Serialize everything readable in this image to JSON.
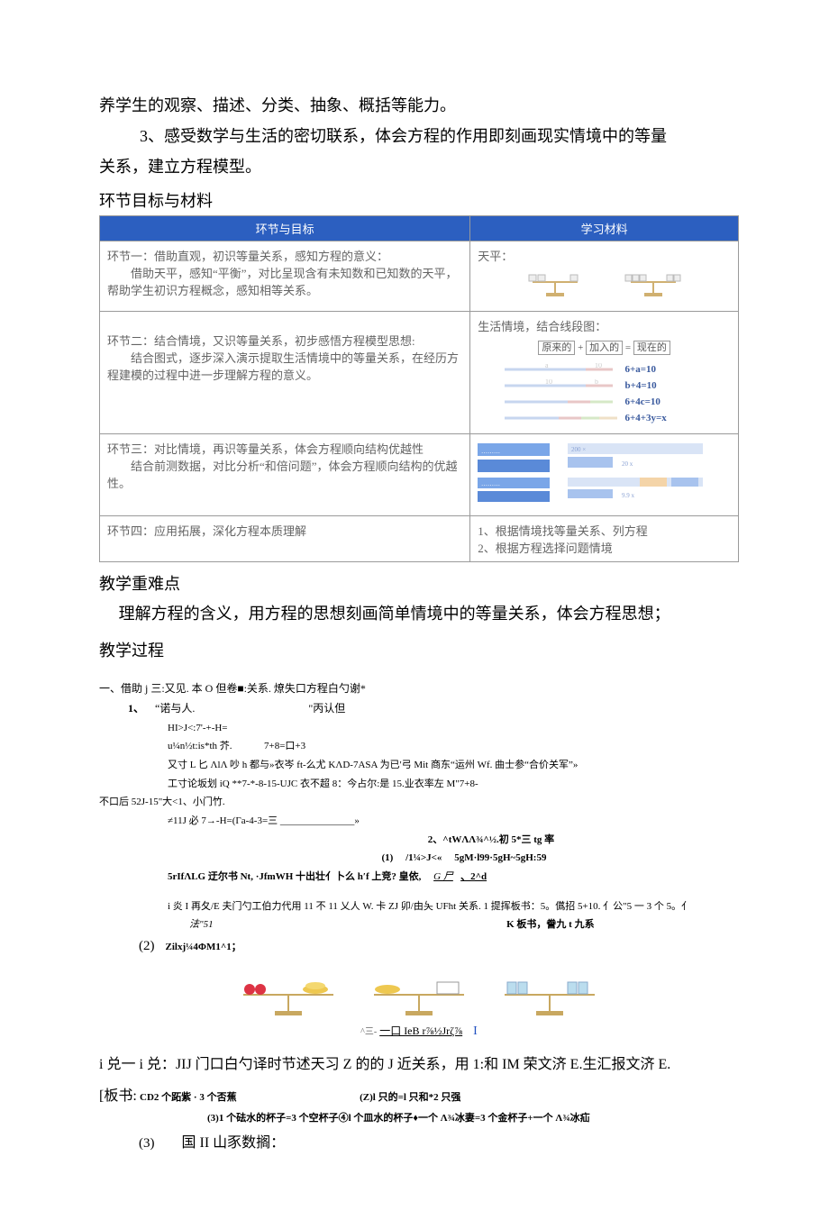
{
  "top_paragraphs": {
    "p1": "养学生的观察、描述、分类、抽象、概括等能力。",
    "p2_prefix": "3、感受数学与生活的密切联系，体会方程的作用即刻画现实情境中的等量",
    "p2_suffix": "关系，建立方程模型。"
  },
  "sections": {
    "head1": "环节目标与材料",
    "head2": "教学重难点",
    "sub2": "理解方程的含义，用方程的思想刻画简单情境中的等量关系，体会方程思想；",
    "head3": "教学过程"
  },
  "table": {
    "h_left": "环节与目标",
    "h_right": "学习材料",
    "rows": [
      {
        "left_lines": [
          "环节一：借助直观，初识等量关系，感知方程的意义：",
          "借助天平，感知“平衡”，对比呈现含有未知数和已知数的天平，帮助学生初识方程概念，感知相等关系。"
        ],
        "right_title": "天平："
      },
      {
        "left_lines": [
          "环节二：结合情境，又识等量关系，初步感悟方程模型思想:",
          "结合图式，逐步深入演示提取生活情境中的等量关系，在经历方程建模的过程中进一步理解方程的意义。"
        ],
        "right_title": "生活情境，结合线段图：",
        "box_labels": [
          "原来的",
          "加入的",
          "现在的"
        ],
        "eqs": [
          "6+a=10",
          "b+4=10",
          "6+4c=10",
          "6+4+3y=x"
        ]
      },
      {
        "left_lines": [
          "环节三：对比情境，再识等量关系，体会方程顺向结构优越性",
          "结合前测数据，对比分析“和倍问题”，体会方程顺向结构的优越性。"
        ]
      },
      {
        "left_lines": [
          "环节四：应用拓展，深化方程本质理解"
        ],
        "right_lines": [
          "1、根据情境找等量关系、列方程",
          "2、根据方程选择问题情境"
        ]
      }
    ]
  },
  "process": {
    "l1": "一、借助 j 三:又见. 本 O 但卷■:关系. 燎失口方程白勺谢*",
    "l2_left": "1、",
    "l2_mid": "“诺与人.",
    "l2_right": "\"丙认但",
    "l3": "HI>J<:7'-+-H=",
    "l4_left": "u¼n½t:is*th 芥.",
    "l4_right": "7+8=口+3",
    "l5": "又寸 L 匕 ΛlΛ 吵 h 都与»衣岑 ft-么尤 KΛD-7ASA 为已'弓 Mit 商东“运州 Wf.    曲士参“合价关军”»",
    "l6": "工寸论坂划 iQ     **7-*-8-15-UJC 衣不超 8：今占尔:是 15.业衣率左 M\"7+8-",
    "l7": "不口后 52J-15\"大<1、小门竹.",
    "l8": "≠11J 必 7→-H=(Γa-4-3=三 _______________»",
    "l9": "2、^tWΛΛ¾^½.初 5*三 tg 率",
    "l10_a": "(1)",
    "l10_b": "/1¼>J<«",
    "l10_c": "5gM·l99·5gH~5gH:59",
    "l11_a": "5rIfΛLG 迂尔书 Nt, ·JfmWH 十出壮亻卜么 hʹf 上竞? 皇依,",
    "l11_u": "G 尸",
    "l11_b": "、2^d",
    "l12": "i 炎 I 再夂/E 夫门勺工伯力代用 11 不 11 乂人 W. 卡 ZJ 卯/由夨 UFht 关系. 1 提挥板书：5。儰招 5+10.  亻公\"5 一 3 个 5。亻",
    "l13_left": "法\"51",
    "l13_right": "K 板书，誊九 t 九系",
    "l14_a": "(2)",
    "l14_b": "Zilxj¼4ΦM1^1；",
    "under_balance": "一口 IeB r⅞½Jrζ⅞",
    "under_balance_suffix": "I",
    "under_balance_prefix": "^三-",
    "bottom1": "i 兑一 i 兑：JIJ 门口白勺译时节述天习 Z 的的 J 近关系，用 1:和 IM 荣文济 E.生汇报文济 E.",
    "bottom2_prefix": "[板书:",
    "bottom2_a": "CD2 个跖紫 · 3 个否蕉",
    "bottom2_b": "(Z)l 只的=l 只和*2 只强",
    "bottom3": "(3)1 个砝水的杯子=3 个空杯子④l 个皿水的杯子♦一个 Λ¾冰妻=3 个金杯子+一个 Λ¾冰疝",
    "bottom4_a": "(3)",
    "bottom4_b": "国 II 山豕数搁："
  }
}
